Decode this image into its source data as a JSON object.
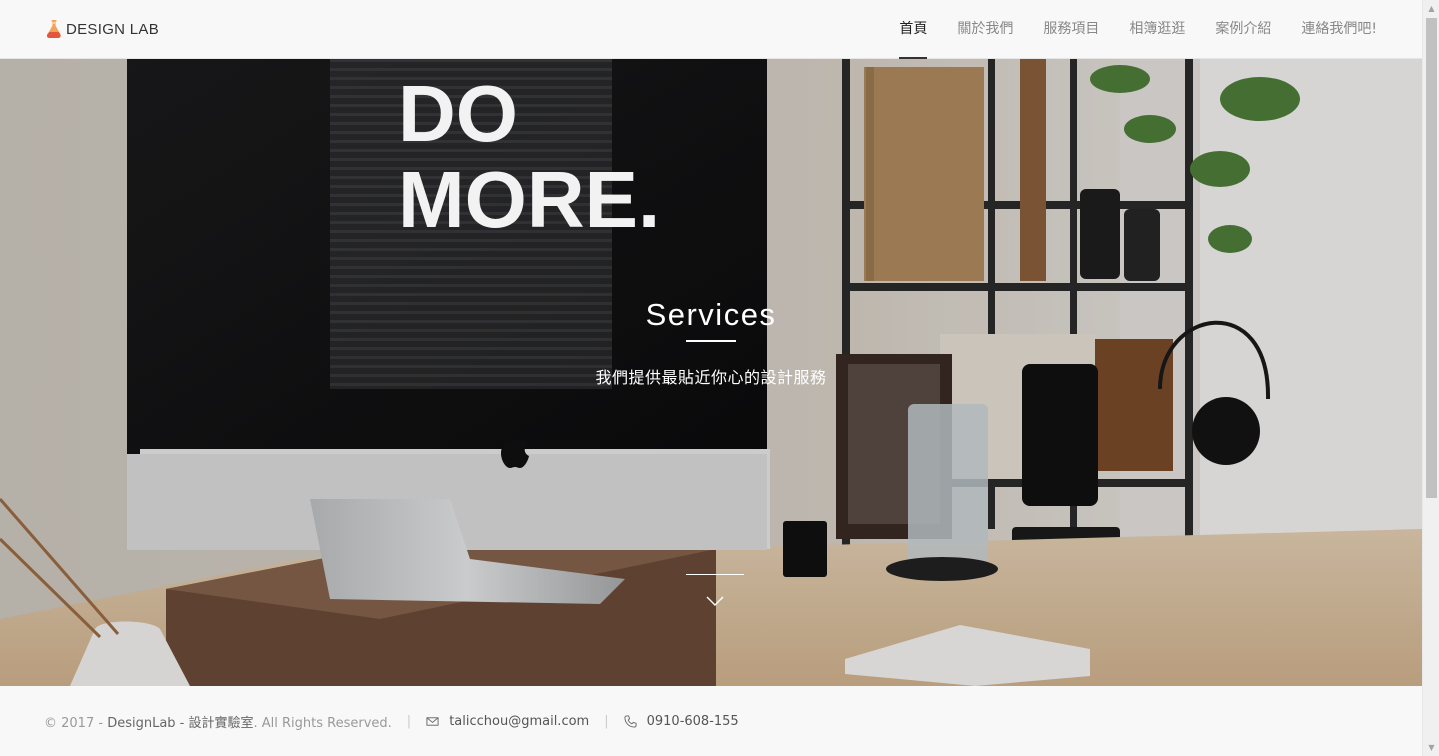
{
  "brand": {
    "name": "DESIGN LAB"
  },
  "nav": {
    "items": [
      {
        "label": "首頁",
        "active": true
      },
      {
        "label": "關於我們"
      },
      {
        "label": "服務項目"
      },
      {
        "label": "相簿逛逛"
      },
      {
        "label": "案例介紹"
      },
      {
        "label": "連絡我們吧!"
      }
    ]
  },
  "hero": {
    "title": "Services",
    "subtitle": "我們提供最貼近你心的設計服務",
    "screen_text_line1": "DO",
    "screen_text_line2": "MORE."
  },
  "footer": {
    "copyright_prefix": "© 2017 -",
    "company": "DesignLab - 設計實驗室",
    "rights": ". All Rights Reserved.",
    "email": "talicchou@gmail.com",
    "phone": "0910-608-155"
  },
  "colors": {
    "accent": "#333333",
    "nav_text": "#888888",
    "footer_bg": "#f8f8f8"
  }
}
